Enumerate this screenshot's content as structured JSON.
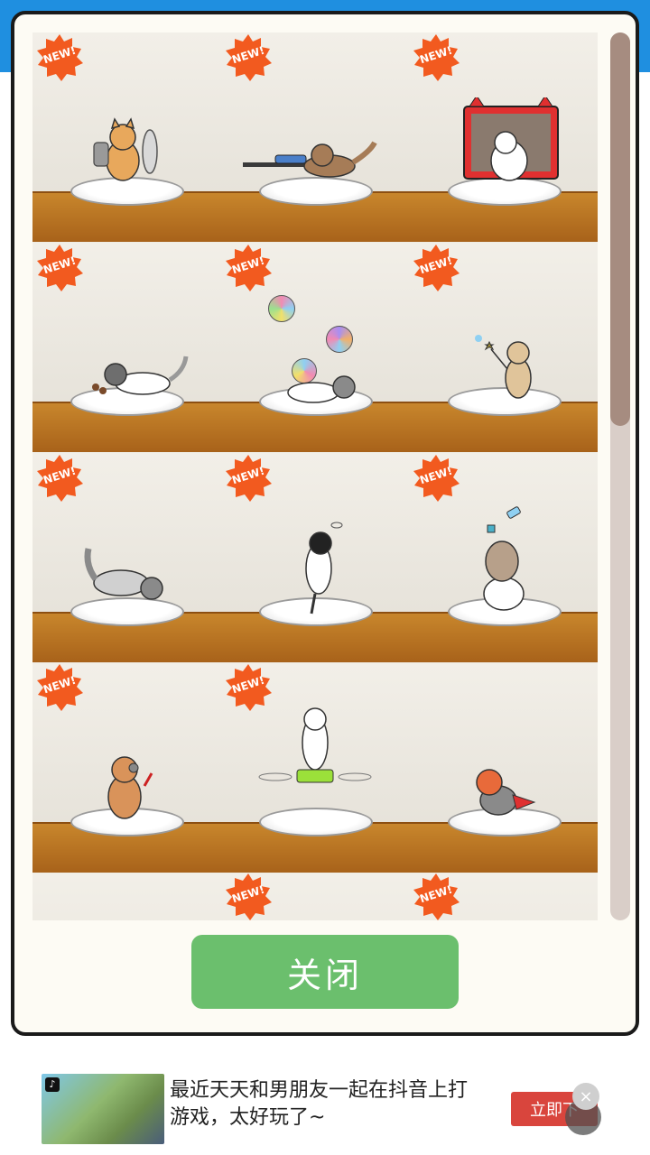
{
  "modal": {
    "badge_text": "NEW!",
    "close_button_label": "关闭"
  },
  "shelves": [
    {
      "cells": [
        {
          "cat": "cat-with-shield",
          "badge": true
        },
        {
          "cat": "cat-with-rifle",
          "badge": true
        },
        {
          "cat": "cat-with-tv",
          "badge": true
        }
      ]
    },
    {
      "cells": [
        {
          "cat": "cat-lying",
          "badge": true
        },
        {
          "cat": "cat-with-balls",
          "badge": true
        },
        {
          "cat": "cat-with-wand",
          "badge": true
        }
      ]
    },
    {
      "cells": [
        {
          "cat": "cat-stretching",
          "badge": true
        },
        {
          "cat": "cat-sleeping-standing",
          "badge": true
        },
        {
          "cat": "cat-stacked",
          "badge": true
        }
      ]
    },
    {
      "cells": [
        {
          "cat": "cat-with-tools",
          "badge": true
        },
        {
          "cat": "cat-on-drone",
          "badge": true
        },
        {
          "cat": "cat-superhero",
          "badge": false
        }
      ]
    },
    {
      "cells": [
        {
          "cat": "",
          "badge": false
        },
        {
          "cat": "",
          "badge": true
        },
        {
          "cat": "",
          "badge": true
        }
      ]
    }
  ],
  "colors": {
    "badge": "#f25a1f",
    "close_button": "#6bbf6d",
    "shelf_wood": "#b8732a",
    "scroll_thumb": "#a68c80",
    "ad_cta": "#d9453d"
  },
  "ad": {
    "text": "最近天天和男朋友一起在抖音上打游戏，太好玩了~",
    "cta_label": "立即下",
    "close_icon": "×",
    "logo": "♪"
  }
}
